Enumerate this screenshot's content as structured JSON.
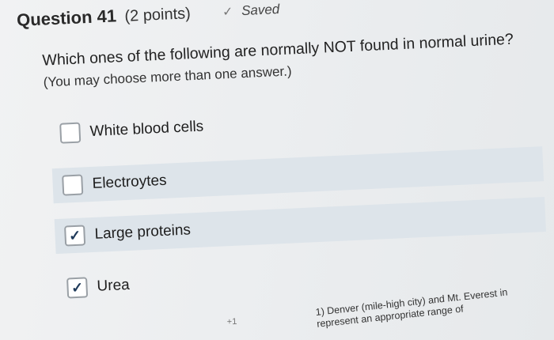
{
  "question": {
    "title": "Question 41",
    "points": "(2 points)",
    "status": "Saved",
    "text": "Which ones of the following are normally NOT found in normal urine?",
    "note": "(You may choose more than one answer.)"
  },
  "options": [
    {
      "label": "White blood cells",
      "checked": false
    },
    {
      "label": "Electroytes",
      "checked": false
    },
    {
      "label": "Large proteins",
      "checked": true
    },
    {
      "label": "Urea",
      "checked": true
    }
  ],
  "next_question_preview": {
    "line1": "1) Denver (mile-high city) and Mt. Everest in",
    "line2": "represent an appropriate range of"
  },
  "stray_mark": "+1",
  "icons": {
    "saved": "checkmark-icon",
    "checkbox_checked": "checkmark-icon"
  }
}
